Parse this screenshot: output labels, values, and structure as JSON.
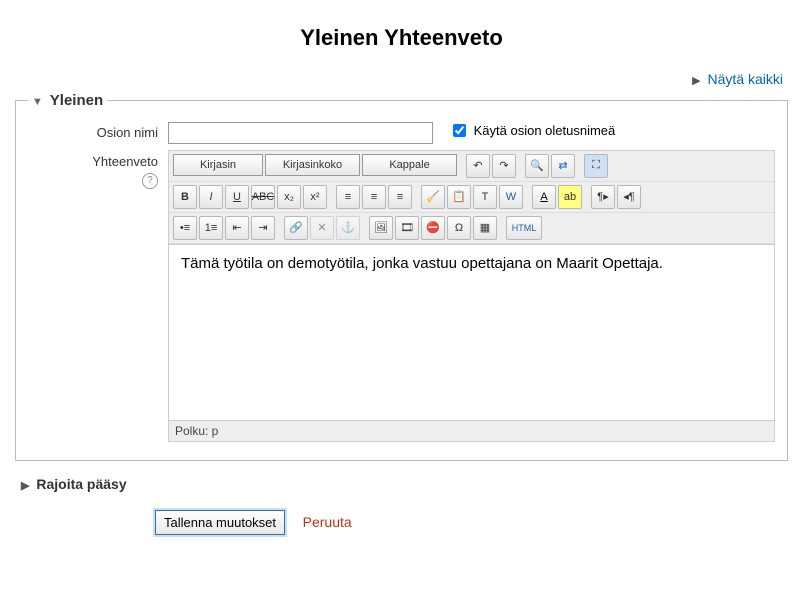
{
  "pageTitle": "Yleinen Yhteenveto",
  "expandAll": "Näytä kaikki",
  "fs": {
    "legend": "Yleinen",
    "sectionNameLabel": "Osion nimi",
    "sectionNameValue": "",
    "useDefaultLabel": "Käytä osion oletusnimeä",
    "summaryLabel": "Yhteenveto",
    "editor": {
      "fontFamily": "Kirjasin",
      "fontSize": "Kirjasinkoko",
      "format": "Kappale",
      "path": "Polku: p",
      "content": "Tämä työtila on demotyötila, jonka vastuu opettajana on Maarit Opettaja."
    }
  },
  "restrictLegend": "Rajoita pääsy",
  "saveLabel": "Tallenna muutokset",
  "cancelLabel": "Peruuta"
}
